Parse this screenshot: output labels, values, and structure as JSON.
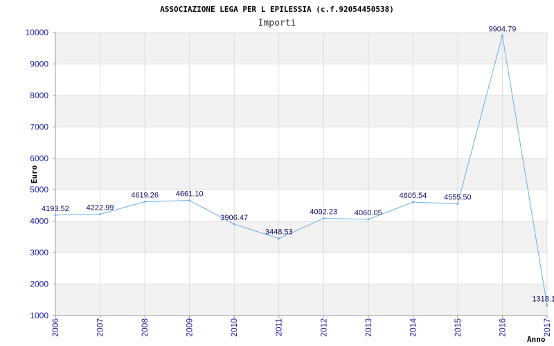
{
  "chart_data": {
    "type": "line",
    "title": "ASSOCIAZIONE LEGA PER L EPILESSIA (c.f.92054450538)",
    "subtitle": "Importi",
    "ylabel": "Euro",
    "xlabel": "Anno",
    "ylim": [
      1000,
      10000
    ],
    "yticks": [
      "1000",
      "2000",
      "3000",
      "4000",
      "5000",
      "6000",
      "7000",
      "8000",
      "9000",
      "10000"
    ],
    "x": [
      "2006",
      "2007",
      "2008",
      "2009",
      "2010",
      "2011",
      "2012",
      "2013",
      "2014",
      "2015",
      "2016",
      "2017"
    ],
    "series": [
      {
        "values": [
          4193.52,
          4222.99,
          4619.26,
          4661.1,
          3906.47,
          3448.53,
          4092.23,
          4060.05,
          4605.54,
          4555.5,
          9904.79,
          1318.1
        ],
        "labels": [
          "4193.52",
          "4222.99",
          "4619.26",
          "4661.10",
          "3906.47",
          "3448.53",
          "4092.23",
          "4060.05",
          "4605.54",
          "4555.50",
          "9904.79",
          "1318.1"
        ]
      }
    ],
    "grid": true,
    "band_colors": [
      "#f2f2f2",
      "#ffffff"
    ],
    "line_color": "#6aaee8"
  }
}
